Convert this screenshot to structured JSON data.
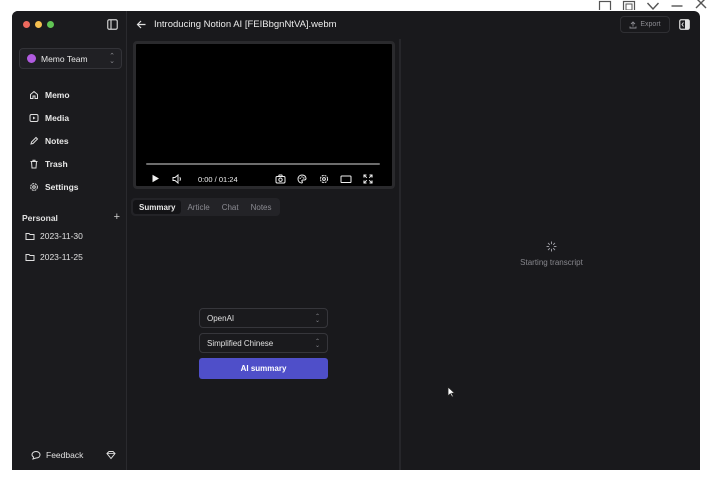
{
  "window": {
    "title": "Introducing Notion AI [FEIBbgnNtVA].webm",
    "export_label": "Export"
  },
  "sidebar": {
    "team": {
      "name": "Memo Team",
      "color": "#b15be0"
    },
    "nav": [
      {
        "label": "Memo",
        "icon": "home-icon"
      },
      {
        "label": "Media",
        "icon": "media-icon"
      },
      {
        "label": "Notes",
        "icon": "pencil-icon"
      },
      {
        "label": "Trash",
        "icon": "trash-icon"
      },
      {
        "label": "Settings",
        "icon": "gear-icon"
      }
    ],
    "section_title": "Personal",
    "folders": [
      {
        "label": "2023-11-30",
        "icon": "folder-icon"
      },
      {
        "label": "2023-11-25",
        "icon": "folder-icon"
      }
    ],
    "feedback_label": "Feedback"
  },
  "video": {
    "time": "0:00 / 01:24",
    "progress": 0
  },
  "tabs": [
    {
      "label": "Summary",
      "active": true
    },
    {
      "label": "Article",
      "active": false
    },
    {
      "label": "Chat",
      "active": false
    },
    {
      "label": "Notes",
      "active": false
    }
  ],
  "ai_form": {
    "provider": "OpenAI",
    "language": "Simplified Chinese",
    "button_label": "AI summary"
  },
  "transcript": {
    "status": "Starting transcript"
  },
  "colors": {
    "accent": "#4f4fc9",
    "background": "#19191c",
    "traffic_red": "#ed6a5e",
    "traffic_yellow": "#f5bf4f",
    "traffic_green": "#61c554"
  }
}
